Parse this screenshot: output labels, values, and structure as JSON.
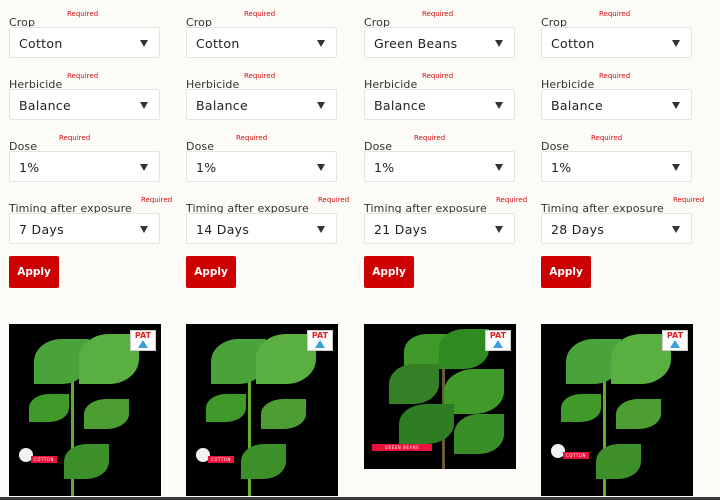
{
  "panels": [
    {
      "fields": [
        {
          "label": "Crop",
          "required": "Required",
          "value": "Cotton"
        },
        {
          "label": "Herbicide",
          "required": "Required",
          "value": "Balance"
        },
        {
          "label": "Dose",
          "required": "Required",
          "value": "1%"
        },
        {
          "label": "Timing after exposure",
          "required": "Required",
          "value": "7 Days"
        }
      ],
      "apply_label": "Apply",
      "image": {
        "subject": "cotton plant",
        "logo": "PAT",
        "badge": "COTTON"
      }
    },
    {
      "fields": [
        {
          "label": "Crop",
          "required": "Required",
          "value": "Cotton"
        },
        {
          "label": "Herbicide",
          "required": "Required",
          "value": "Balance"
        },
        {
          "label": "Dose",
          "required": "Required",
          "value": "1%"
        },
        {
          "label": "Timing after exposure",
          "required": "Required",
          "value": "14 Days"
        }
      ],
      "apply_label": "Apply",
      "image": {
        "subject": "cotton plant",
        "logo": "PAT",
        "badge": "COTTON"
      }
    },
    {
      "fields": [
        {
          "label": "Crop",
          "required": "Required",
          "value": "Green Beans"
        },
        {
          "label": "Herbicide",
          "required": "Required",
          "value": "Balance"
        },
        {
          "label": "Dose",
          "required": "Required",
          "value": "1%"
        },
        {
          "label": "Timing after exposure",
          "required": "Required",
          "value": "21 Days"
        }
      ],
      "apply_label": "Apply",
      "image": {
        "subject": "green bean plant",
        "logo": "PAT",
        "badge": "GREEN BEANS"
      }
    },
    {
      "fields": [
        {
          "label": "Crop",
          "required": "Required",
          "value": "Cotton"
        },
        {
          "label": "Herbicide",
          "required": "Required",
          "value": "Balance"
        },
        {
          "label": "Dose",
          "required": "Required",
          "value": "1%"
        },
        {
          "label": "Timing after exposure",
          "required": "Required",
          "value": "28 Days"
        }
      ],
      "apply_label": "Apply",
      "image": {
        "subject": "cotton plant",
        "logo": "PAT",
        "badge": "COTTON"
      }
    }
  ],
  "colors": {
    "accent": "#cc0000",
    "required": "#d21010",
    "background": "#fcfbf8"
  }
}
